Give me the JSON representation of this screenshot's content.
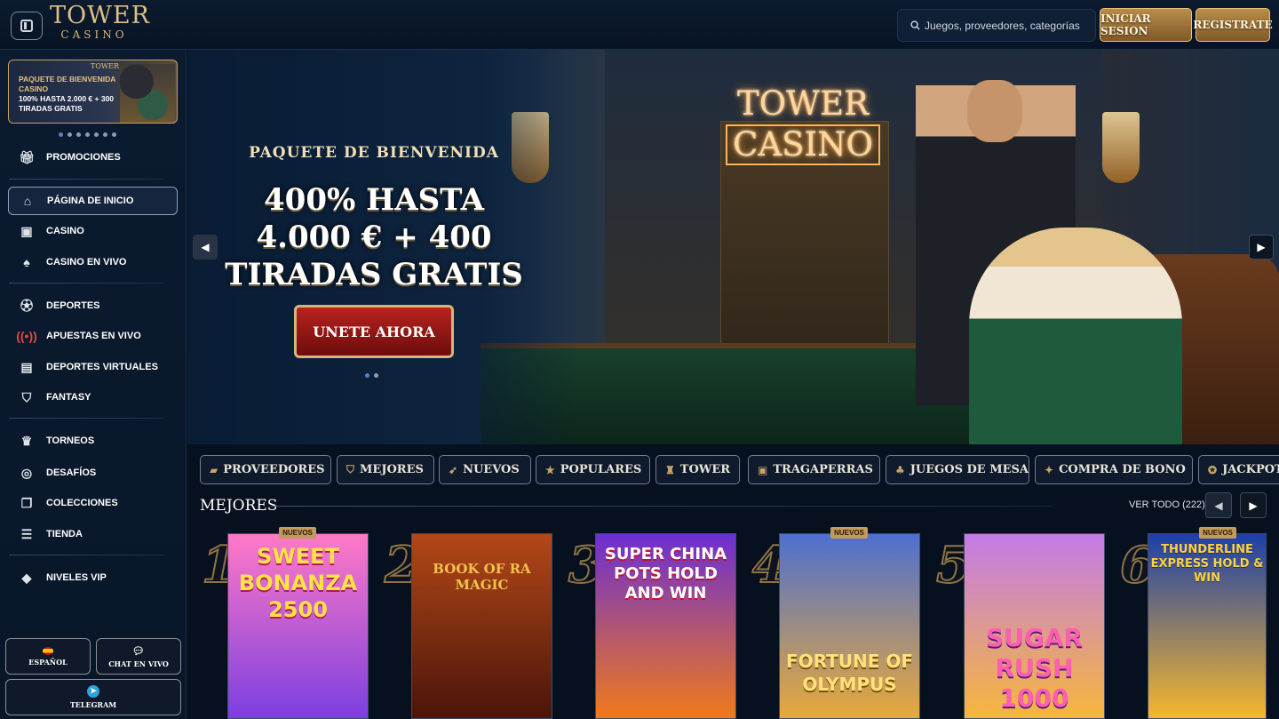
{
  "header": {
    "logo_main": "TOWER",
    "logo_sub": "CASINO",
    "search_placeholder": "Juegos, proveedores, categorías",
    "login_label": "INICIAR SESION",
    "register_label": "REGISTRATE",
    "accent": "#c69a55"
  },
  "sidebar": {
    "promo": {
      "line1": "PAQUETE DE BIENVENIDA",
      "line2": "CASINO",
      "line3": "100% HASTA 2.000 € + 300",
      "line4": "TIRADAS GRATIS",
      "brand": "TOWER"
    },
    "slide_count": 7,
    "active_slide": 0,
    "items": [
      {
        "label": "PROMOCIONES",
        "icon": "gift-icon"
      },
      {
        "label": "PÁGINA DE INICIO",
        "icon": "home-icon",
        "active": true
      },
      {
        "label": "CASINO",
        "icon": "slot-icon"
      },
      {
        "label": "CASINO EN VIVO",
        "icon": "cards-icon"
      },
      {
        "label": "DEPORTES",
        "icon": "soccer-ball-icon"
      },
      {
        "label": "APUESTAS EN VIVO",
        "icon": "broadcast-icon"
      },
      {
        "label": "DEPORTES VIRTUALES",
        "icon": "virtual-sports-icon"
      },
      {
        "label": "FANTASY",
        "icon": "shield-icon"
      },
      {
        "label": "TORNEOS",
        "icon": "trophy-icon"
      },
      {
        "label": "DESAFÍOS",
        "icon": "target-icon"
      },
      {
        "label": "COLECCIONES",
        "icon": "collection-icon"
      },
      {
        "label": "TIENDA",
        "icon": "coins-icon"
      },
      {
        "label": "NIVELES VIP",
        "icon": "diamond-icon"
      }
    ],
    "language_label": "ESPAÑOL",
    "chat_label": "CHAT EN VIVO",
    "telegram_label": "TELEGRAM"
  },
  "hero": {
    "neon_line1": "TOWER",
    "neon_line2": "CASINO",
    "kicker": "PAQUETE DE BIENVENIDA",
    "headline_1": "400% HASTA",
    "headline_2": "4.000 € + 400",
    "headline_3": "TIRADAS GRATIS",
    "cta_label": "UNETE AHORA",
    "slide_count": 2,
    "active_slide": 0
  },
  "categories": [
    {
      "label": "PROVEEDORES",
      "icon": "provider-icon"
    },
    {
      "label": "MEJORES",
      "icon": "badge-icon"
    },
    {
      "label": "NUEVOS",
      "icon": "rocket-icon"
    },
    {
      "label": "POPULARES",
      "icon": "star-icon"
    },
    {
      "label": "TOWER",
      "icon": "tower-icon"
    },
    {
      "label": "TRAGAPERRAS",
      "icon": "slot-machine-icon"
    },
    {
      "label": "JUEGOS DE MESA",
      "icon": "table-games-icon"
    },
    {
      "label": "COMPRA DE BONO",
      "icon": "bonus-icon"
    },
    {
      "label": "JACKPOT",
      "icon": "jackpot-icon"
    }
  ],
  "section": {
    "title": "MEJORES",
    "see_all": "VER TODO (222)"
  },
  "games": [
    {
      "rank": "1",
      "title": "SWEET BONANZA 2500",
      "badge": "NUEVOS",
      "colors": [
        "#ff79c6",
        "#7b3fe0"
      ]
    },
    {
      "rank": "2",
      "title": "BOOK OF RA MAGIC",
      "badge": "",
      "colors": [
        "#b34718",
        "#4a150a"
      ]
    },
    {
      "rank": "3",
      "title": "SUPER CHINA POTS HOLD AND WIN",
      "badge": "",
      "colors": [
        "#6c2fd2",
        "#f07a1a"
      ]
    },
    {
      "rank": "4",
      "title": "FORTUNE OF OLYMPUS",
      "badge": "NUEVOS",
      "colors": [
        "#4d6fd0",
        "#e8a93a"
      ]
    },
    {
      "rank": "5",
      "title": "SUGAR RUSH 1000",
      "badge": "",
      "colors": [
        "#c27be8",
        "#f6b73c"
      ]
    },
    {
      "rank": "6",
      "title": "THUNDERLINE EXPRESS HOLD & WIN",
      "badge": "NUEVOS",
      "colors": [
        "#1c3fa8",
        "#f5b82e"
      ]
    }
  ]
}
